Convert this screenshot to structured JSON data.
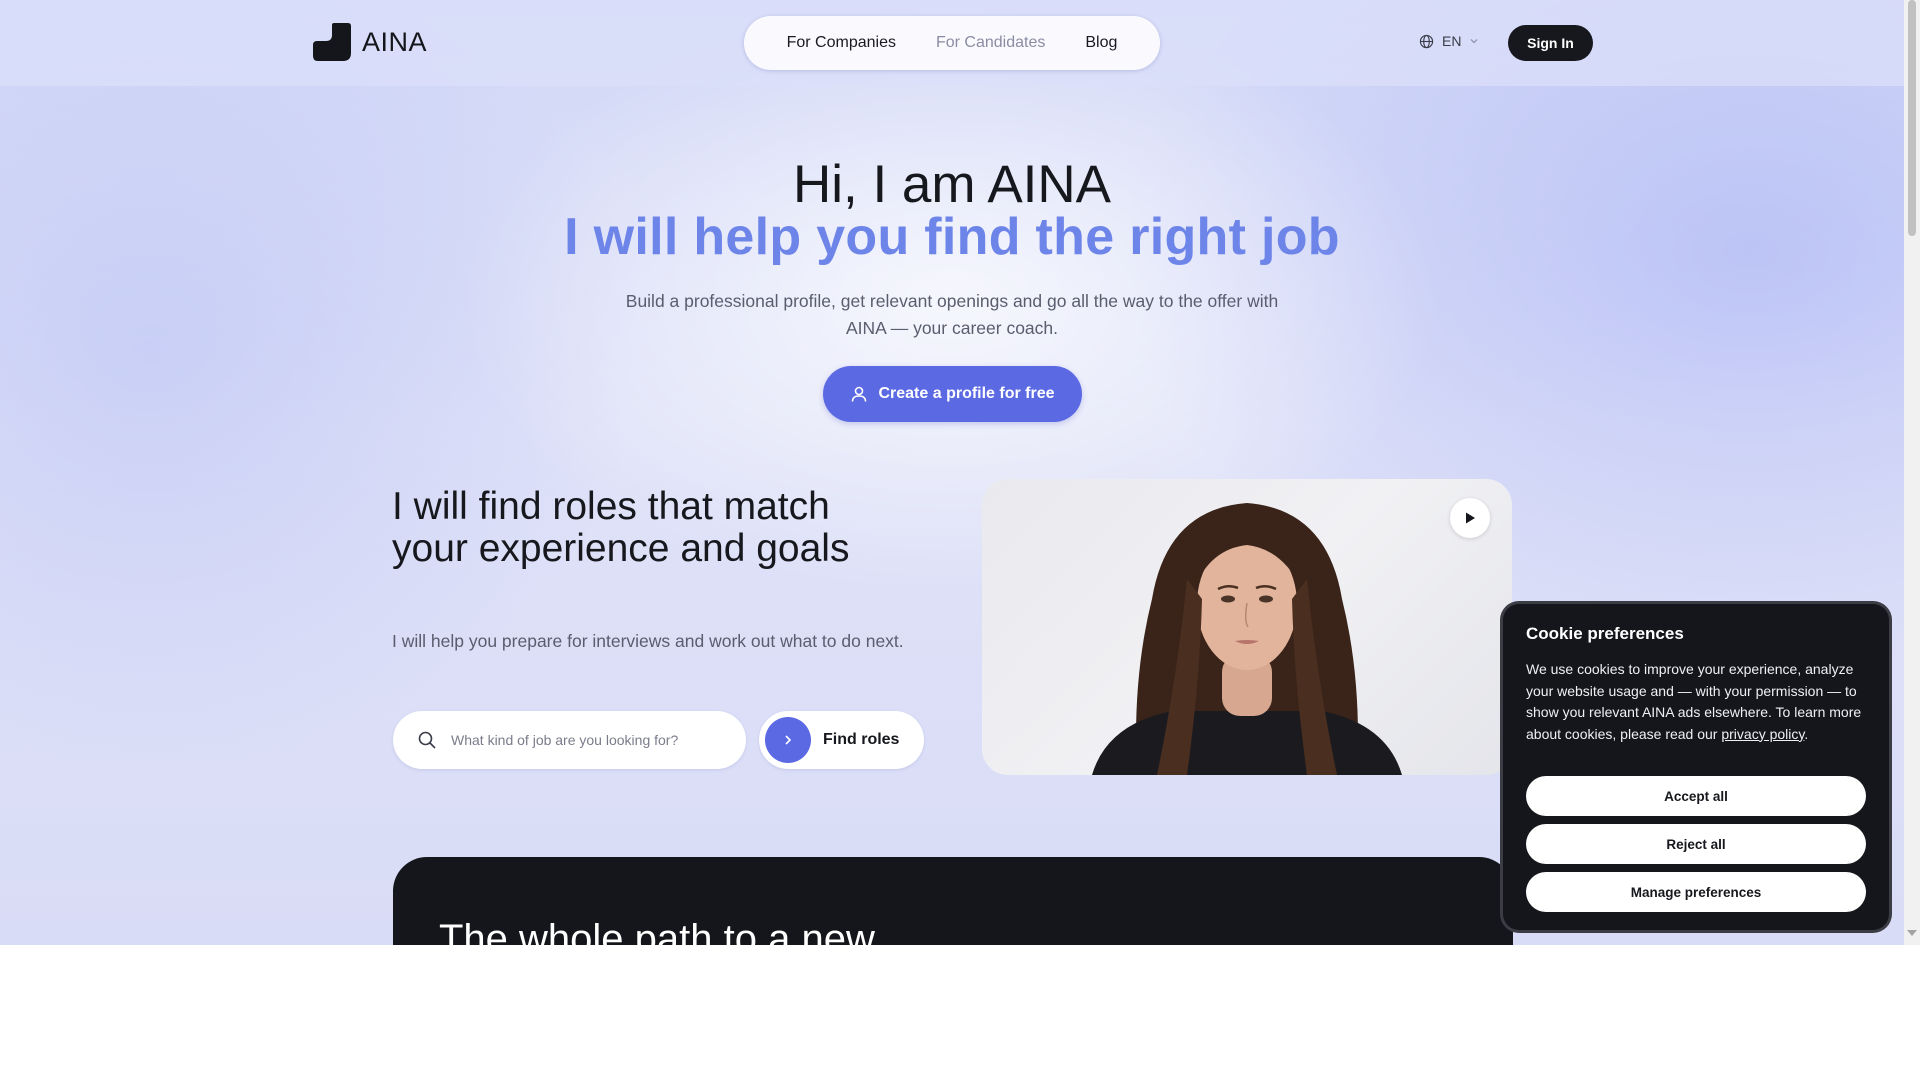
{
  "header": {
    "logo_text": "AINA",
    "nav": [
      {
        "label": "For Companies"
      },
      {
        "label": "For Candidates"
      },
      {
        "label": "Blog"
      }
    ],
    "language": "EN",
    "sign_in": "Sign In"
  },
  "hero": {
    "title": "Hi, I am AINA",
    "subtitle": "I will help you find the right job",
    "description": "Build a professional profile, get relevant openings and go all the way to the offer with AINA — your career coach.",
    "cta": "Create a profile for free"
  },
  "roles": {
    "title": "I will find roles that match your experience and goals",
    "description": "I will help you prepare for interviews and work out what to do next.",
    "search_placeholder": "What kind of job are you looking for?",
    "button": "Find roles"
  },
  "dark_section": {
    "title": "The whole path to a new"
  },
  "cookie": {
    "title": "Cookie preferences",
    "text": "We use cookies to improve your experience, analyze your website usage and — with your permission — to show you relevant AINA ads elsewhere. To learn more about cookies, please read our ",
    "link": "privacy policy",
    "text_end": ".",
    "accept": "Accept all",
    "reject": "Reject all",
    "manage": "Manage preferences"
  },
  "colors": {
    "accent": "#5b69e3",
    "subtitle": "#6d84e8",
    "dark": "#15161b"
  },
  "icons": [
    "logo-icon",
    "globe-icon",
    "chevron-down-icon",
    "user-icon",
    "search-icon",
    "chevron-right-icon",
    "play-icon"
  ]
}
